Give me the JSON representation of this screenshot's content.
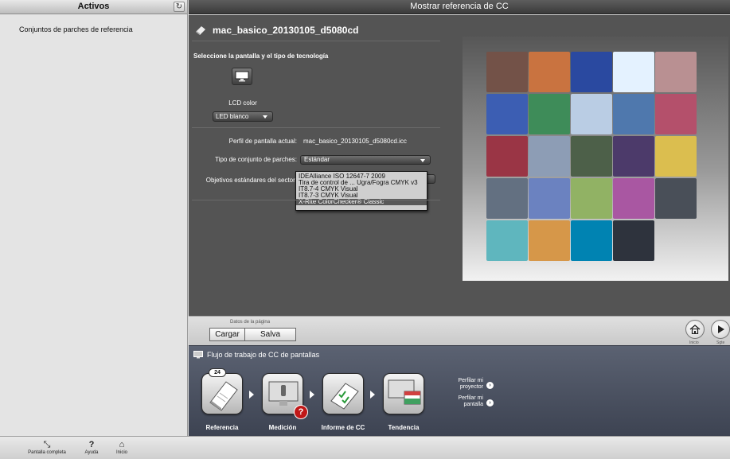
{
  "sidebar": {
    "title": "Activos",
    "refresh_icon": "↻",
    "items": [
      {
        "label": "Conjuntos de parches de referencia"
      }
    ]
  },
  "main": {
    "header_title": "Mostrar referencia de CC",
    "doc_title": "mac_basico_20130105_d5080cd",
    "section_title": "Seleccione la pantalla y el tipo de tecnología",
    "lcd_label": "LCD color",
    "led_select_value": "LED blanco",
    "profile_label": "Perfil de pantalla actual:",
    "profile_value": "mac_basico_20130105_d5080cd.icc",
    "patch_type_label": "Tipo de conjunto de parches:",
    "patch_type_value": "Estándar",
    "standards_label": "Objetivos estándares del sector:",
    "standards_options": [
      {
        "label": "IDEAlliance ISO 12647-7 2009",
        "selected": false
      },
      {
        "label": "Tira de control de ... Ugra/Fogra CMYK v3",
        "selected": false
      },
      {
        "label": "IT8.7-4 CMYK Visual",
        "selected": false
      },
      {
        "label": "IT8.7-3 CMYK Visual",
        "selected": false
      },
      {
        "label": "X-Rite ColorChecker® Classic",
        "selected": true
      }
    ]
  },
  "checker": {
    "patches": [
      "#735248",
      "#c97340",
      "#2a49a0",
      "#e4f2ff",
      "#b99092",
      "#3c5eb3",
      "#3e8c59",
      "#bacde4",
      "#4f78ad",
      "#b4506b",
      "#9a3545",
      "#8d9db5",
      "#4d6049",
      "#4c3a6a",
      "#dbbe4f",
      "#637081",
      "#6b82c0",
      "#91b264",
      "#a957a2",
      "#494f58",
      "#5fb6be",
      "#d69749",
      "#0083b2",
      "#2e333d"
    ]
  },
  "page_bar": {
    "label": "Datos de la página",
    "load": "Cargar",
    "save": "Salva",
    "home_label": "Inicio",
    "next_label": "Sgte"
  },
  "workflow": {
    "title": "Flujo de trabajo de CC de pantallas",
    "badge_count": "24",
    "error_badge": "?",
    "steps": [
      {
        "label": "Referencia"
      },
      {
        "label": "Medición"
      },
      {
        "label": "Informe de CC"
      },
      {
        "label": "Tendencia"
      }
    ],
    "profile_projector": "Perfilar mi proyector",
    "profile_display": "Perfilar mi pantalla"
  },
  "bottom_bar": {
    "fullscreen": "Pantalla completa",
    "help": "Ayuda",
    "home": "Inicio"
  }
}
